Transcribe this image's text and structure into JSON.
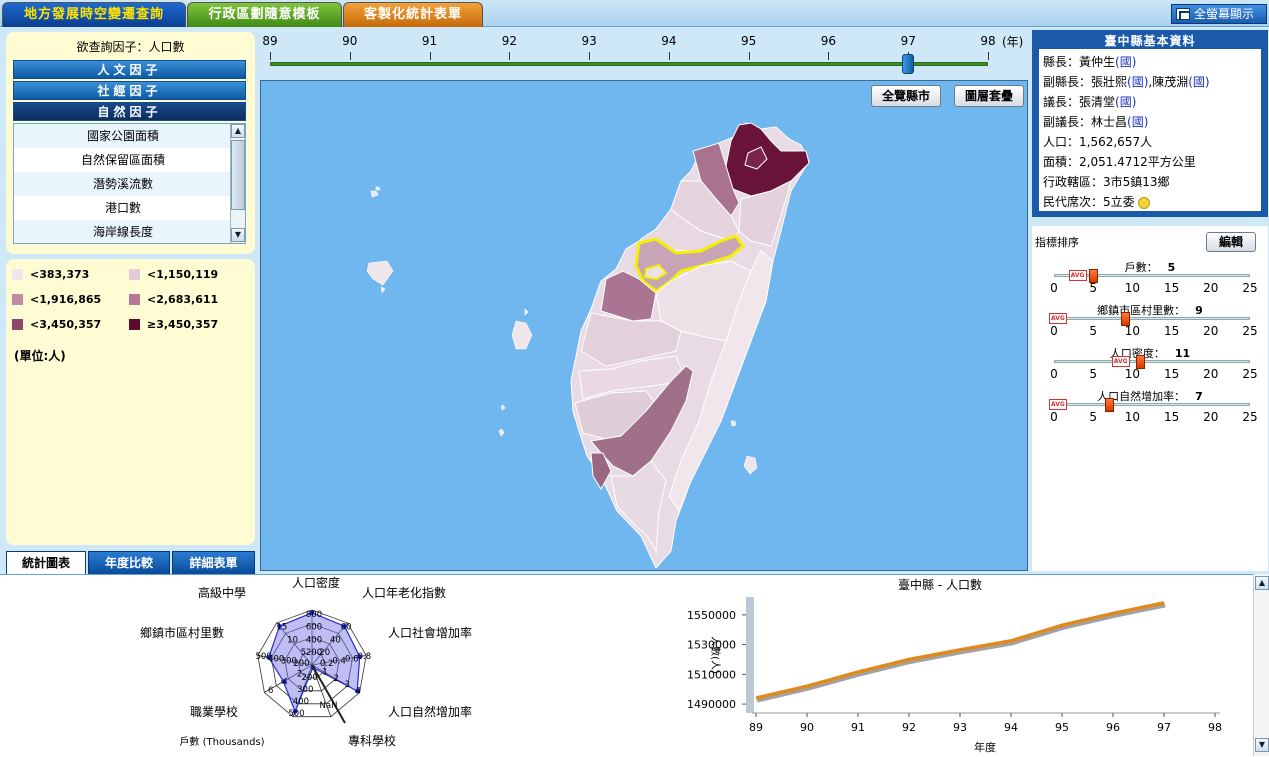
{
  "top_tabs": [
    "地方發展時空變遷查詢",
    "行政區劃隨意模板",
    "客製化統計表單"
  ],
  "fullscreen_label": "全螢幕顯示",
  "query": {
    "label": "欲查詢因子：人口數",
    "categories": [
      "人文因子",
      "社經因子",
      "自然因子"
    ],
    "active_category": "自然因子",
    "items": [
      "國家公園面積",
      "自然保留區面積",
      "潛勢溪流數",
      "港口數",
      "海岸線長度"
    ]
  },
  "legend": {
    "items": [
      {
        "label": "<383,373",
        "color": "#f1e6ec"
      },
      {
        "label": "<1,150,119",
        "color": "#e3ccd7"
      },
      {
        "label": "<1,916,865",
        "color": "#c18ba4"
      },
      {
        "label": "<2,683,611",
        "color": "#b67a96"
      },
      {
        "label": "<3,450,357",
        "color": "#8e4766"
      },
      {
        "label": "≥3,450,357",
        "color": "#5e0a33"
      }
    ],
    "unit": "(單位:人)"
  },
  "left_bottom_tabs": [
    "統計圖表",
    "年度比較",
    "詳細表單"
  ],
  "timeline": {
    "years": [
      "89",
      "90",
      "91",
      "92",
      "93",
      "94",
      "95",
      "96",
      "97",
      "98"
    ],
    "unit": "(年)",
    "selected": "97"
  },
  "map_buttons": [
    "全覽縣市",
    "圖層套疊"
  ],
  "info": {
    "title": "臺中縣基本資料",
    "rows": [
      {
        "label": "縣長：",
        "value": "黃仲生",
        "party": "(國)"
      },
      {
        "label": "副縣長：",
        "value": "張壯熙",
        "party": "(國)",
        "extra": ",陳茂淵",
        "party2": "(國)"
      },
      {
        "label": "議長：",
        "value": "張清堂",
        "party": "(國)"
      },
      {
        "label": "副議長：",
        "value": "林士昌",
        "party": "(國)"
      },
      {
        "label": "人口：",
        "value": "1,562,657人"
      },
      {
        "label": "面積：",
        "value": "2,051.4712平方公里"
      },
      {
        "label": "行政轄區：",
        "value": "3市5鎮13鄉"
      },
      {
        "label": "民代席次：",
        "value": "5立委"
      }
    ]
  },
  "ranking": {
    "title": "指標排序",
    "edit_label": "編輯",
    "ticks": [
      "0",
      "5",
      "10",
      "15",
      "20",
      "25"
    ],
    "avg_label": "AVG",
    "sliders": [
      {
        "label": "戶數：",
        "value": "5",
        "pos": 5,
        "avg": 3
      },
      {
        "label": "鄉鎮市區村里數：",
        "value": "9",
        "pos": 9,
        "avg": 0.5
      },
      {
        "label": "人口密度：",
        "value": "11",
        "pos": 11,
        "avg": 8.5
      },
      {
        "label": "人口自然增加率：",
        "value": "7",
        "pos": 7,
        "avg": 0.5
      }
    ]
  },
  "radar": {
    "axes": [
      "人口密度",
      "人口年老化指數",
      "人口社會增加率",
      "人口自然增加率",
      "專科學校",
      "戶數 (Thousands)",
      "職業學校",
      "鄉鎮市區村里數",
      "高級中學"
    ],
    "axis_ticks": {
      "density": [
        "200",
        "400",
        "600",
        "800"
      ],
      "aging": [
        "20",
        "40",
        "60"
      ],
      "social": [
        "0.2",
        "0.4",
        "0.6",
        "0.8"
      ],
      "natural": [
        "1",
        "2",
        "3",
        "4"
      ],
      "college": [
        "NaN"
      ],
      "households": [
        "200",
        "300",
        "400",
        "500"
      ],
      "vocational": [
        "2",
        "4",
        "6"
      ],
      "villages": [
        "200",
        "300",
        "400",
        "500"
      ],
      "senior": [
        "5",
        "10",
        "15"
      ]
    }
  },
  "chart_data": {
    "type": "line",
    "title": "臺中縣 - 人口數",
    "xlabel": "年度",
    "ylabel": "人數(人)",
    "x": [
      "89",
      "90",
      "91",
      "92",
      "93",
      "94",
      "95",
      "96",
      "97",
      "98"
    ],
    "y_ticks": [
      "1490000",
      "1510000",
      "1530000",
      "1550000"
    ],
    "ylim": [
      1484000,
      1562000
    ],
    "series": [
      {
        "values": [
          1494000,
          1502000,
          1511500,
          1520000,
          1526500,
          1532500,
          1543000,
          1551000,
          1558000
        ],
        "color": "#e08a1e"
      }
    ]
  }
}
